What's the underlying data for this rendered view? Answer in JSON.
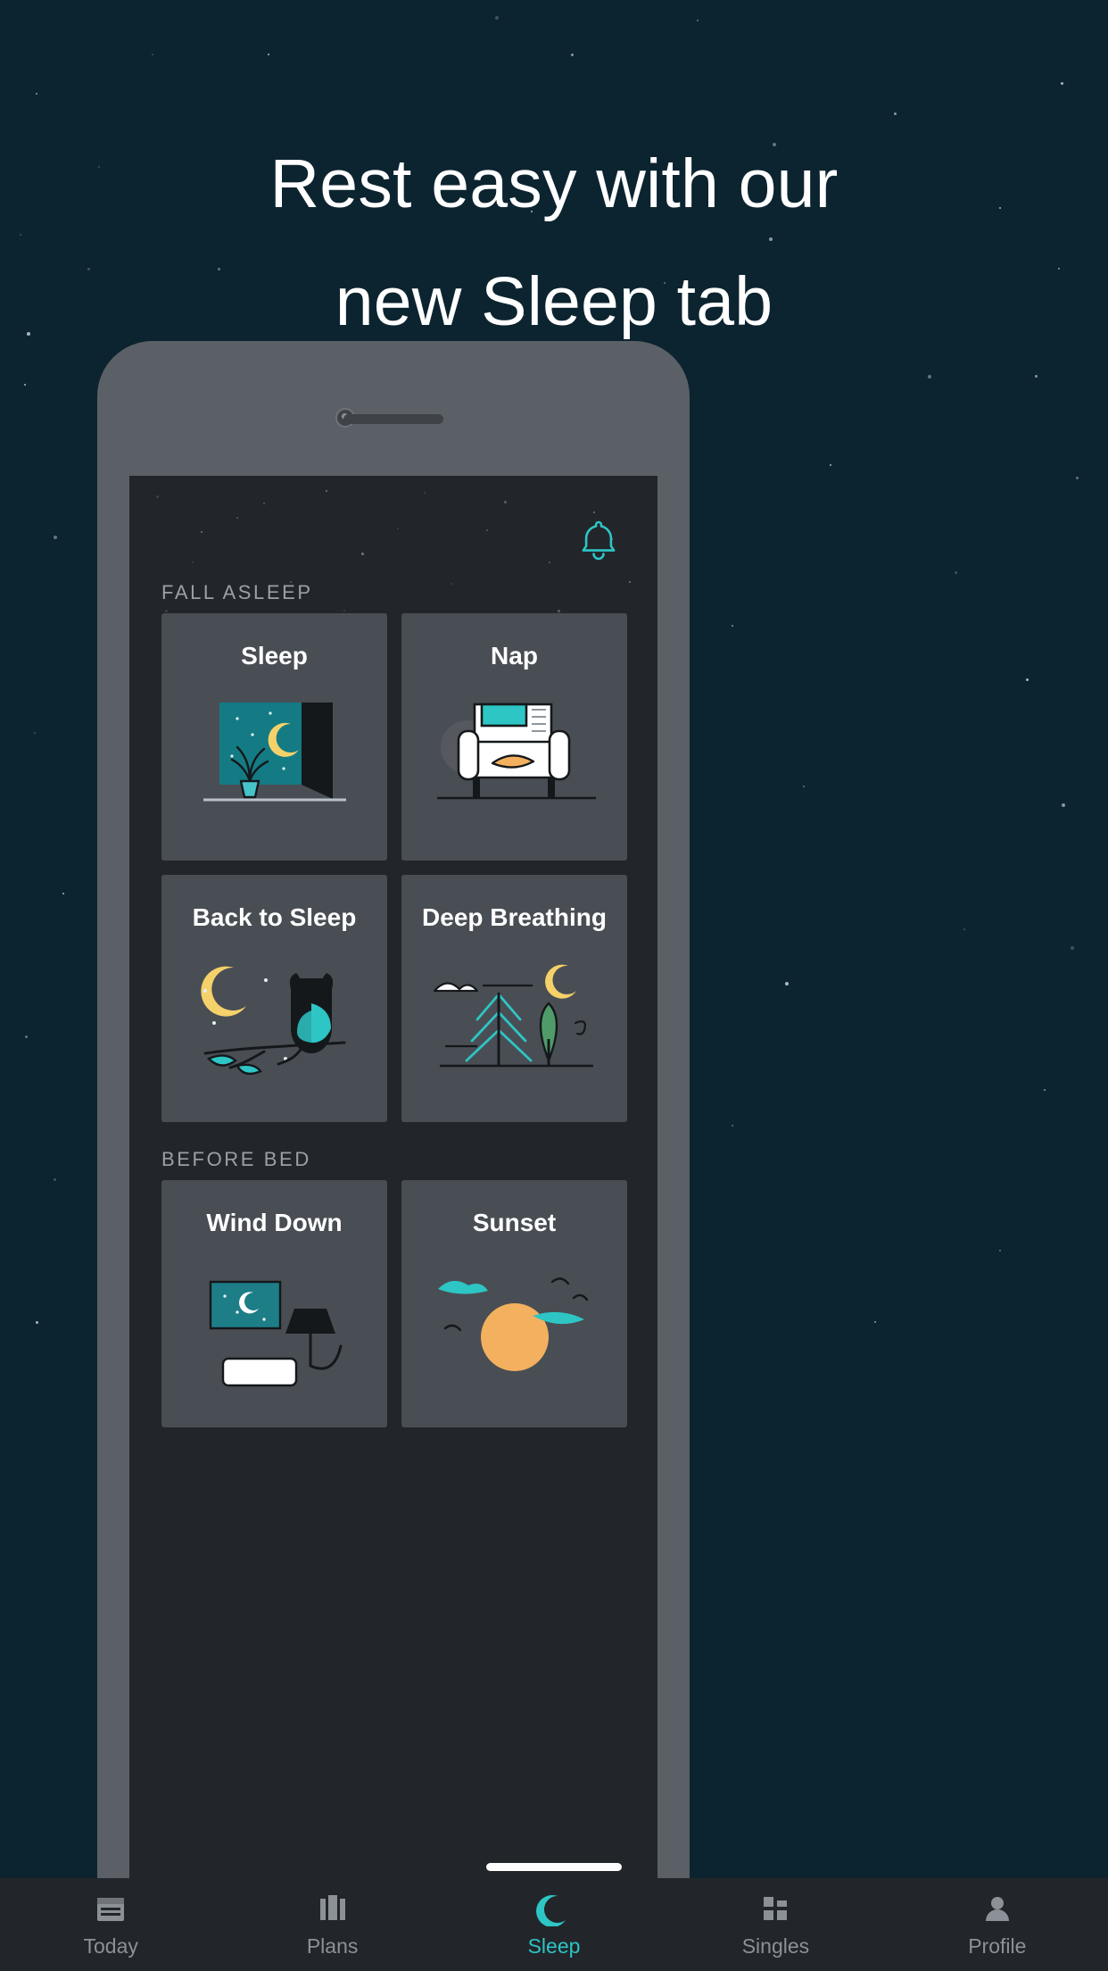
{
  "headline": "Rest easy with our\nnew Sleep tab",
  "colors": {
    "page_background": "#0c2430",
    "phone_body": "#5b6066",
    "screen_background": "#22262a",
    "card_background": "#494e54",
    "accent": "#2ec5c5",
    "moon_yellow": "#f5d16a",
    "muted_text": "#9aa0a6"
  },
  "app": {
    "notification_icon": "bell-icon",
    "sections": [
      {
        "label": "FALL ASLEEP",
        "cards": [
          {
            "title": "Sleep",
            "art": "window-night-plant-moon"
          },
          {
            "title": "Nap",
            "art": "armchair-with-cat"
          },
          {
            "title": "Back to Sleep",
            "art": "owl-on-branch-with-moon"
          },
          {
            "title": "Deep Breathing",
            "art": "forest-trees-with-moon"
          }
        ]
      },
      {
        "label": "BEFORE BED",
        "cards": [
          {
            "title": "Wind Down",
            "art": "bedside-lamp-and-night-picture"
          },
          {
            "title": "Sunset",
            "art": "sunset-with-birds"
          }
        ]
      }
    ],
    "tabs": [
      {
        "label": "Today",
        "icon": "calendar-icon",
        "active": false
      },
      {
        "label": "Plans",
        "icon": "columns-icon",
        "active": false
      },
      {
        "label": "Sleep",
        "icon": "moon-icon",
        "active": true
      },
      {
        "label": "Singles",
        "icon": "squares-icon",
        "active": false
      },
      {
        "label": "Profile",
        "icon": "person-icon",
        "active": false
      }
    ]
  }
}
